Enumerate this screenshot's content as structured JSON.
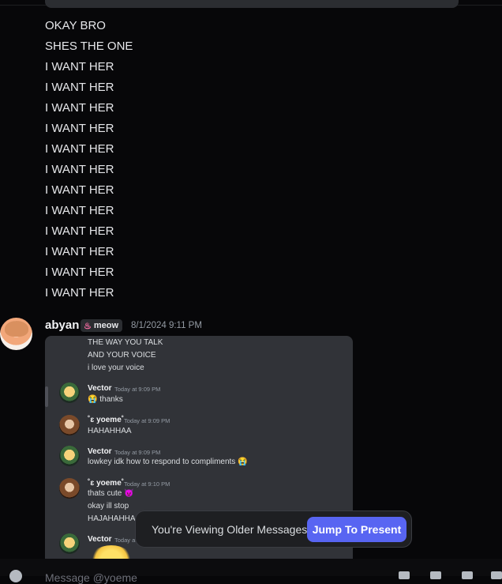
{
  "message_lines": [
    "OKAY BRO",
    "SHES THE ONE",
    "I WANT HER",
    "I WANT HER",
    "I WANT HER",
    "I WANT HER",
    "I WANT HER",
    "I WANT HER",
    "I WANT HER",
    "I WANT HER",
    "I WANT HER",
    "I WANT HER",
    "I WANT HER",
    "I WANT HER"
  ],
  "message": {
    "username": "abyan",
    "tag": "meow",
    "tag_icon": "flame-icon",
    "timestamp": "8/1/2024 9:11 PM"
  },
  "screenshot": {
    "top_lines": [
      "THE WAY YOU TALK",
      "AND YOUR VOICE",
      "i love your voice"
    ],
    "messages": [
      {
        "name": "Vector",
        "time": "Today at 9:09 PM",
        "lines": [
          "😭 thanks"
        ]
      },
      {
        "name": "˚ɛ yoeme˚",
        "time": "Today at 9:09 PM",
        "lines": [
          "HAHAHHAA"
        ]
      },
      {
        "name": "Vector",
        "time": "Today at 9:09 PM",
        "lines": [
          "lowkey idk how to respond to compliments 😭"
        ]
      },
      {
        "name": "˚ɛ yoeme˚",
        "time": "Today at 9:10 PM",
        "lines": [
          "thats cute 😈",
          "okay ill stop",
          "HAJAHAHHA"
        ]
      },
      {
        "name": "Vector",
        "time": "Today at",
        "lines": []
      }
    ]
  },
  "jump_bar": {
    "text": "You're Viewing Older Messages",
    "button": "Jump To Present",
    "button_color": "#5865f2"
  },
  "composer": {
    "placeholder": "Message @yoeme"
  }
}
